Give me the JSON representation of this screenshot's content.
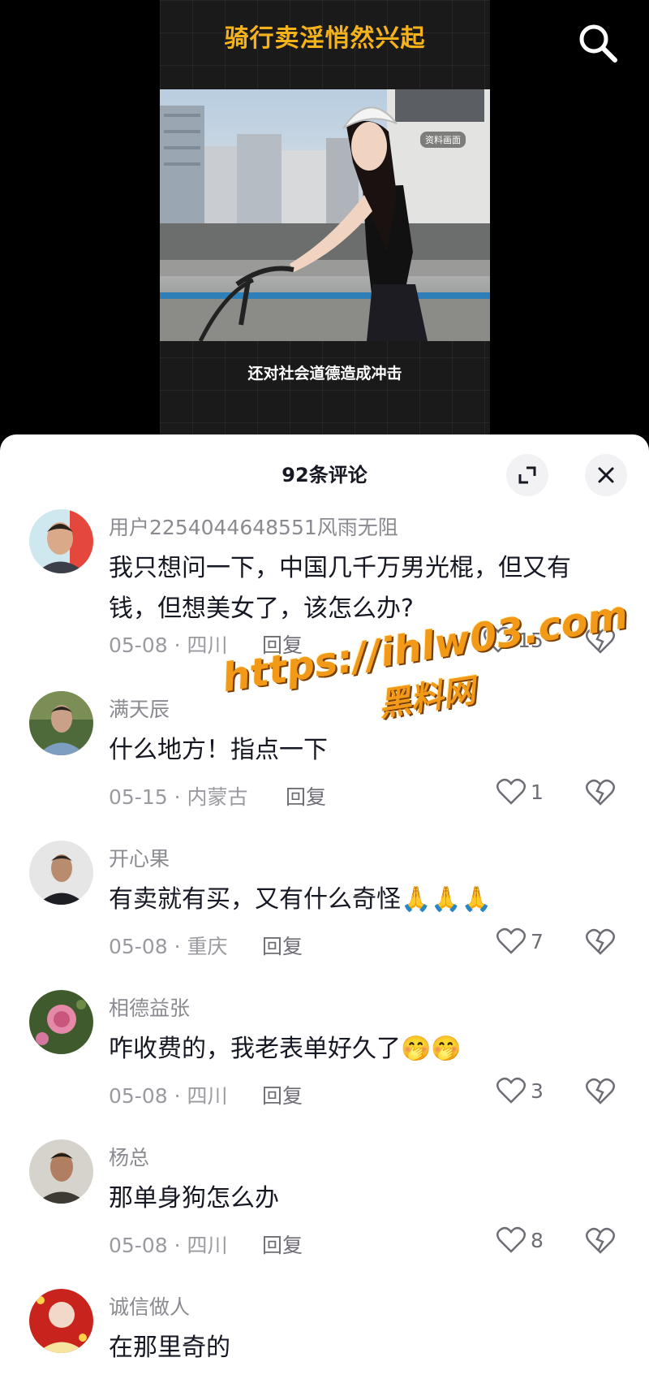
{
  "video": {
    "headline": "骑行卖淫悄然兴起",
    "photo_label": "资料画面",
    "subtitle": "还对社会道德造成冲击",
    "search_icon": "search-icon"
  },
  "sheet": {
    "title": "92条评论",
    "expand_icon": "expand-icon",
    "close_icon": "close-icon"
  },
  "comments": [
    {
      "username": "用户2254044648551风雨无阻",
      "text": "我只想问一下，中国几千万男光棍，但又有钱，但想美女了，该怎么办?",
      "meta": "05-08 · 四川",
      "reply": "回复",
      "likes": "15"
    },
    {
      "username": "满天辰",
      "text": "什么地方！指点一下",
      "meta": "05-15 · 内蒙古",
      "reply": "回复",
      "likes": "1"
    },
    {
      "username": "开心果",
      "text": "有卖就有买，又有什么奇怪🙏🙏🙏",
      "meta": "05-08 · 重庆",
      "reply": "回复",
      "likes": "7"
    },
    {
      "username": "相德益张",
      "text": "咋收费的，我老表单好久了🤭🤭",
      "meta": "05-08 · 四川",
      "reply": "回复",
      "likes": "3"
    },
    {
      "username": "杨总",
      "text": "那单身狗怎么办",
      "meta": "05-08 · 四川",
      "reply": "回复",
      "likes": "8"
    },
    {
      "username": "诚信做人",
      "text": "在那里奇的"
    }
  ],
  "watermark": {
    "url": "https://ihlw03.com",
    "name": "黑料网"
  },
  "colors": {
    "headline": "#f5b21a",
    "watermark": "#f29a18",
    "text_primary": "#161823",
    "text_secondary": "#8a8b91"
  }
}
